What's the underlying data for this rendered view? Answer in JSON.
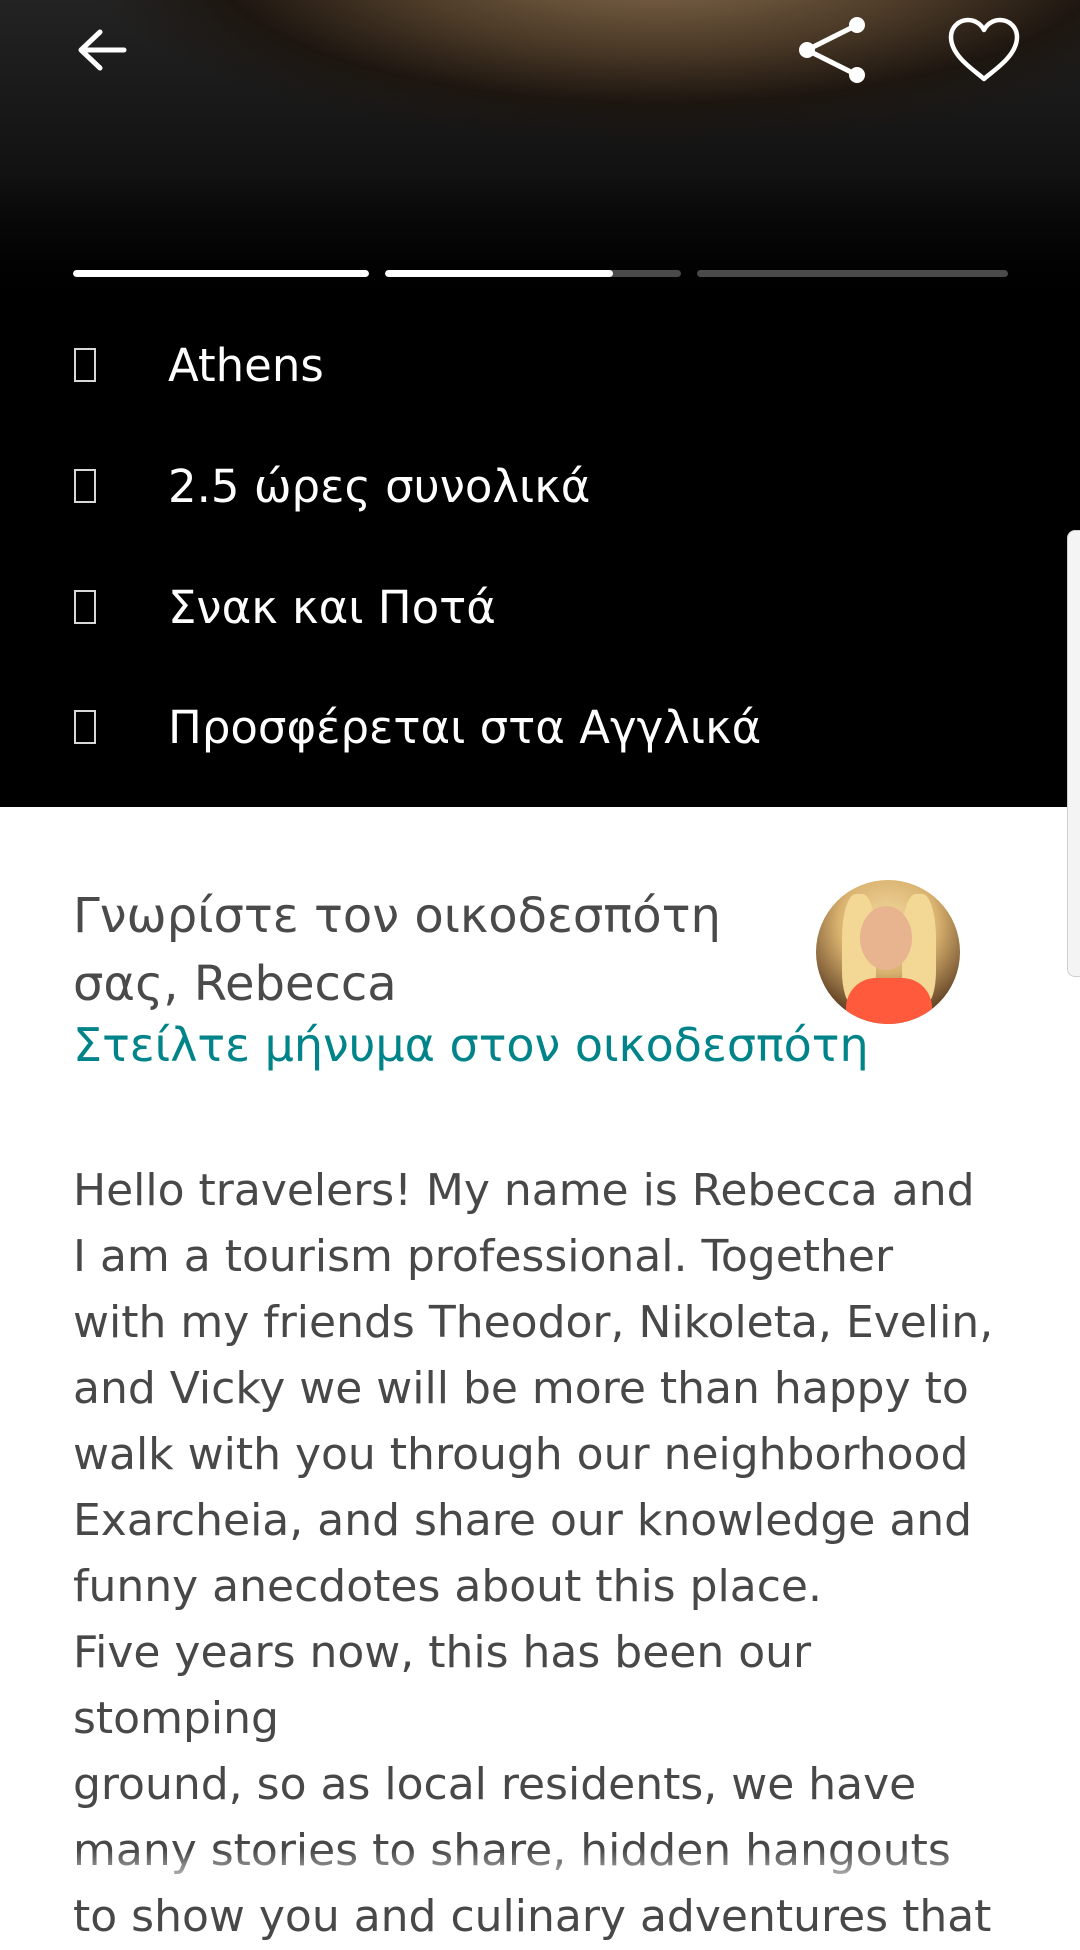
{
  "hero": {
    "progress": [
      1.0,
      0.77,
      0.0
    ],
    "info": [
      {
        "icon": "location-icon",
        "text": "Athens"
      },
      {
        "icon": "clock-icon",
        "text": "2.5 ώρες συνολικά"
      },
      {
        "icon": "food-icon",
        "text": "Σνακ και Ποτά"
      },
      {
        "icon": "language-icon",
        "text": "Προσφέρεται στα Αγγλικά"
      }
    ]
  },
  "host": {
    "title_line1": "Γνωρίστε τον οικοδεσπότη",
    "title_line2": "σας, Rebecca",
    "message_link": "Στείλτε μήνυμα στον οικοδεσπότη"
  },
  "bio": {
    "paragraph1_lines": [
      "Hello travelers! My name is Rebecca and",
      "I am a tourism professional. Together",
      "with my friends  Theodor, Nikoleta, Evelin,",
      "and Vicky we will be more than happy to",
      "walk with you through our neighborhood",
      "Exarcheia,  and share our knowledge and",
      "funny anecdotes about this place."
    ],
    "paragraph2_lines": [
      "Five years now, this has been our stomping",
      "ground, so as local residents, we have",
      "many stories to share, hidden hangouts",
      "to show you and culinary adventures that"
    ]
  },
  "colors": {
    "accent": "#008489",
    "hero_bg": "#000000",
    "body_text": "#484848"
  }
}
